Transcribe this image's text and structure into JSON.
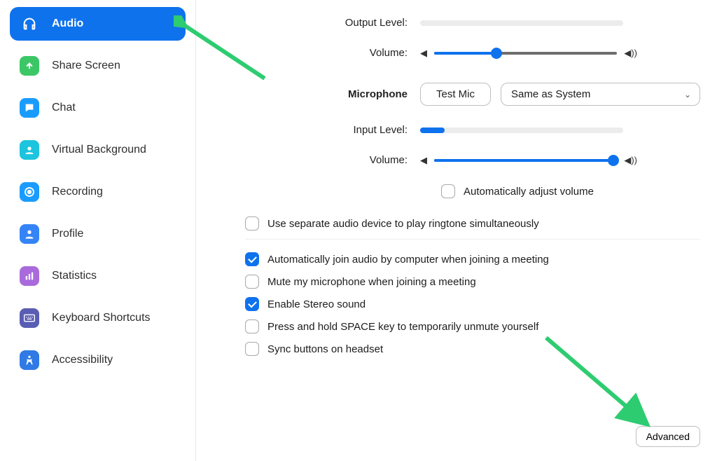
{
  "sidebar": {
    "items": [
      {
        "label": "Audio"
      },
      {
        "label": "Share Screen"
      },
      {
        "label": "Chat"
      },
      {
        "label": "Virtual Background"
      },
      {
        "label": "Recording"
      },
      {
        "label": "Profile"
      },
      {
        "label": "Statistics"
      },
      {
        "label": "Keyboard Shortcuts"
      },
      {
        "label": "Accessibility"
      }
    ]
  },
  "main": {
    "output_level_label": "Output Level:",
    "output_volume_label": "Volume:",
    "output_volume_percent": 34,
    "microphone_label": "Microphone",
    "test_mic_label": "Test Mic",
    "mic_device_selected": "Same as System",
    "input_level_label": "Input Level:",
    "input_level_percent": 12,
    "input_volume_label": "Volume:",
    "input_volume_percent": 98,
    "auto_adjust_label": "Automatically adjust volume",
    "auto_adjust_checked": false,
    "opt_separate_device": "Use separate audio device to play ringtone simultaneously",
    "opt_separate_device_checked": false,
    "opt_auto_join": "Automatically join audio by computer when joining a meeting",
    "opt_auto_join_checked": true,
    "opt_mute_mic": "Mute my microphone when joining a meeting",
    "opt_mute_mic_checked": false,
    "opt_stereo": "Enable Stereo sound",
    "opt_stereo_checked": true,
    "opt_space_unmute": "Press and hold SPACE key to temporarily unmute yourself",
    "opt_space_unmute_checked": false,
    "opt_sync_headset": "Sync buttons on headset",
    "opt_sync_headset_checked": false,
    "advanced_label": "Advanced"
  }
}
